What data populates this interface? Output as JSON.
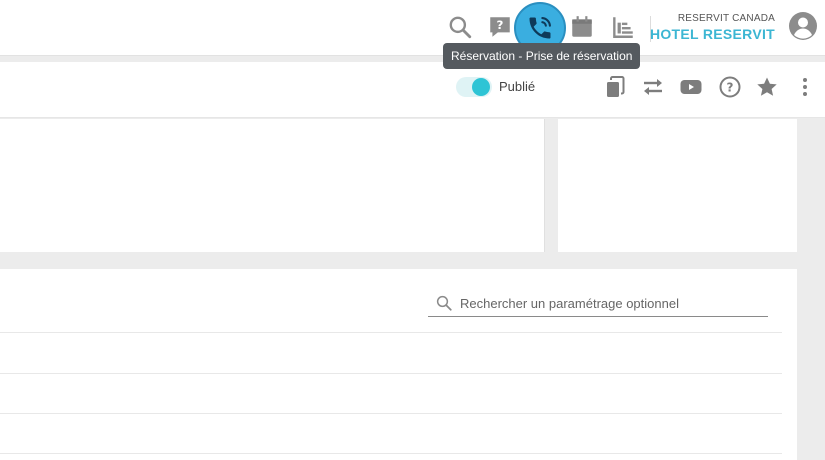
{
  "header": {
    "company": "RESERVIT CANADA",
    "hotel": "HOTEL RESERVIT",
    "icons": [
      "search-icon",
      "help-chat-icon",
      "phone-reservation-icon",
      "calendar-icon",
      "stats-icon",
      "account-icon"
    ],
    "tooltip": "Réservation - Prise de réservation",
    "accent_color": "#3cb6d3",
    "highlight_color": "#3aaee0"
  },
  "subbar": {
    "published_label": "Publié",
    "published": true,
    "actions": [
      "copy-icon",
      "transfer-icon",
      "youtube-icon",
      "help-icon",
      "favorite-star-icon",
      "more-menu-icon"
    ]
  },
  "options": {
    "search_placeholder": "Rechercher un paramétrage optionnel"
  }
}
